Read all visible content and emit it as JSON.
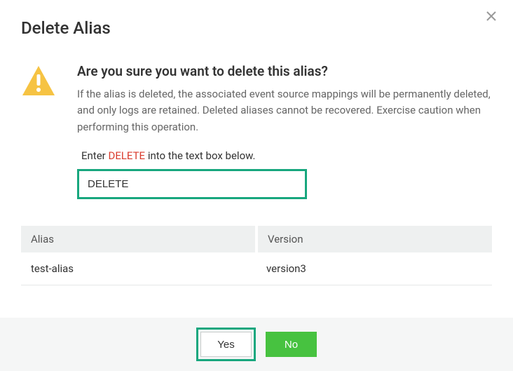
{
  "dialog": {
    "title": "Delete Alias",
    "heading": "Are you sure you want to delete this alias?",
    "description": "If the alias is deleted, the associated event source mappings will be permanently deleted, and only logs are retained. Deleted aliases cannot be recovered. Exercise caution when performing this operation.",
    "enter_prefix": "Enter ",
    "enter_keyword": "DELETE",
    "enter_suffix": " into the text box below.",
    "input_value": "DELETE"
  },
  "table": {
    "headers": {
      "alias": "Alias",
      "version": "Version"
    },
    "row": {
      "alias": "test-alias",
      "version": "version3"
    }
  },
  "buttons": {
    "yes": "Yes",
    "no": "No"
  },
  "colors": {
    "accent_green_border": "#18a77e",
    "primary_button": "#47c240",
    "warning_icon": "#f6c343",
    "keyword_red": "#d93a2b"
  }
}
